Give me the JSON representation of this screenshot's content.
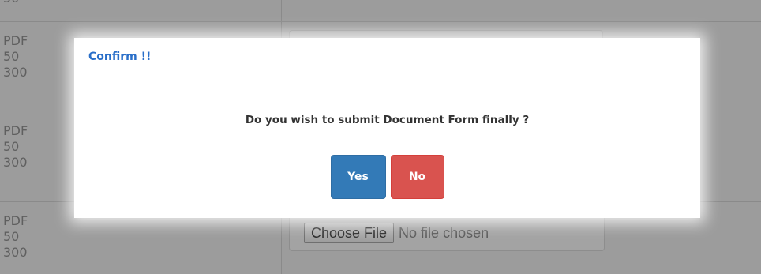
{
  "background": {
    "rows": [
      {
        "lines": [
          "50"
        ]
      },
      {
        "lines": [
          "PDF",
          "50",
          "300"
        ]
      },
      {
        "lines": [
          "PDF",
          "50",
          "300"
        ]
      },
      {
        "lines": [
          "PDF",
          "50",
          "300"
        ]
      }
    ],
    "file_input": {
      "button_label": "Choose File",
      "status_text": "No file chosen"
    }
  },
  "dialog": {
    "title": "Confirm !!",
    "message": "Do you wish to submit Document Form finally ?",
    "yes_label": "Yes",
    "no_label": "No"
  },
  "colors": {
    "title": "#2a6fc9",
    "yes_button": "#337ab7",
    "no_button": "#d9534f"
  }
}
